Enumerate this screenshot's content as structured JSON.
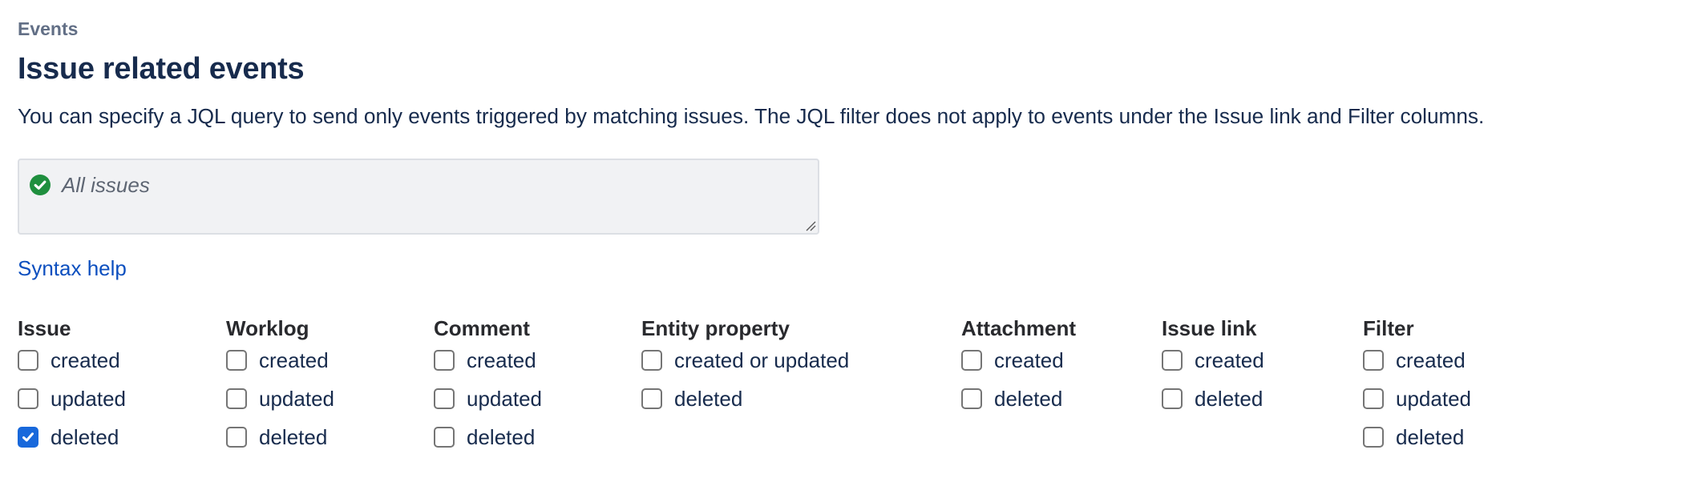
{
  "header": {
    "section_label": "Events",
    "title": "Issue related events",
    "description": "You can specify a JQL query to send only events triggered by matching issues. The JQL filter does not apply to events under the Issue link and Filter columns."
  },
  "jql": {
    "value": "All issues",
    "status": "valid",
    "status_icon": "check-circle-icon",
    "status_color": "#1f8f3e"
  },
  "syntax_help": {
    "label": "Syntax help"
  },
  "colors": {
    "accent": "#1868db",
    "link": "#0c4fbf",
    "text": "#172b4d",
    "heading": "#292a2e",
    "muted": "#626f86",
    "field_background": "#f1f2f4"
  },
  "columns": [
    {
      "heading": "Issue",
      "options": [
        {
          "label": "created",
          "checked": false
        },
        {
          "label": "updated",
          "checked": false
        },
        {
          "label": "deleted",
          "checked": true
        }
      ]
    },
    {
      "heading": "Worklog",
      "options": [
        {
          "label": "created",
          "checked": false
        },
        {
          "label": "updated",
          "checked": false
        },
        {
          "label": "deleted",
          "checked": false
        }
      ]
    },
    {
      "heading": "Comment",
      "options": [
        {
          "label": "created",
          "checked": false
        },
        {
          "label": "updated",
          "checked": false
        },
        {
          "label": "deleted",
          "checked": false
        }
      ]
    },
    {
      "heading": "Entity property",
      "options": [
        {
          "label": "created or updated",
          "checked": false
        },
        {
          "label": "deleted",
          "checked": false
        }
      ]
    },
    {
      "heading": "Attachment",
      "options": [
        {
          "label": "created",
          "checked": false
        },
        {
          "label": "deleted",
          "checked": false
        }
      ]
    },
    {
      "heading": "Issue link",
      "options": [
        {
          "label": "created",
          "checked": false
        },
        {
          "label": "deleted",
          "checked": false
        }
      ]
    },
    {
      "heading": "Filter",
      "options": [
        {
          "label": "created",
          "checked": false
        },
        {
          "label": "updated",
          "checked": false
        },
        {
          "label": "deleted",
          "checked": false
        }
      ]
    }
  ]
}
